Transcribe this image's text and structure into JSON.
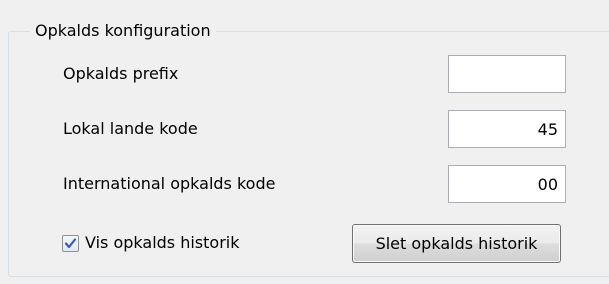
{
  "group": {
    "title": "Opkalds konfiguration"
  },
  "fields": {
    "prefix": {
      "label": "Opkalds prefix",
      "value": ""
    },
    "local_country_code": {
      "label": "Lokal lande kode",
      "value": "45"
    },
    "international_code": {
      "label": "International opkalds kode",
      "value": "00"
    }
  },
  "history": {
    "checkbox_label": "Vis opkalds historik",
    "checked": true,
    "delete_button_label": "Slet opkalds historik"
  },
  "colors": {
    "window_background": "#f0f0f0",
    "group_border": "#d5dfe5",
    "checkmark": "#3b5ca8"
  }
}
